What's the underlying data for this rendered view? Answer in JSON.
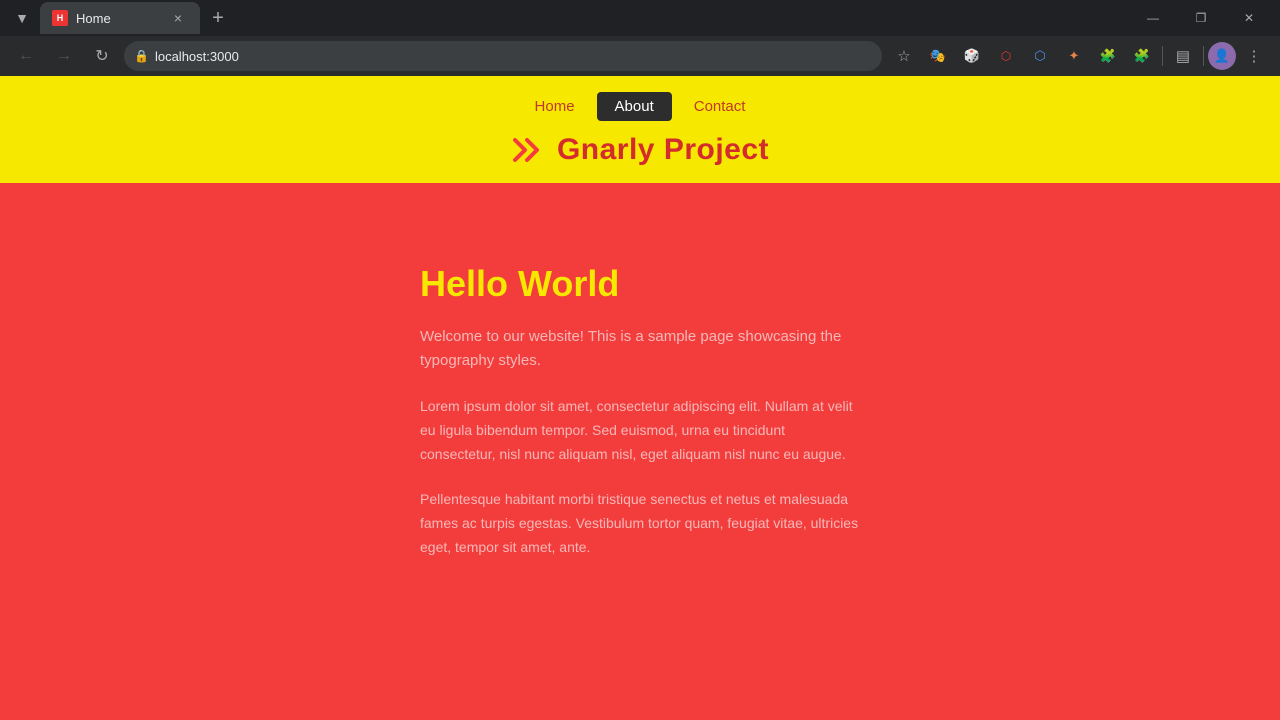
{
  "browser": {
    "tab": {
      "favicon_label": "H",
      "title": "Home",
      "close_label": "×"
    },
    "new_tab_label": "+",
    "window_controls": {
      "minimize": "—",
      "maximize": "❐",
      "close": "✕"
    },
    "toolbar": {
      "back_label": "←",
      "forward_label": "→",
      "reload_label": "↻",
      "url": "localhost:3000",
      "bookmark_label": "☆",
      "menu_label": "⋮"
    }
  },
  "site": {
    "nav": {
      "home_label": "Home",
      "about_label": "About",
      "contact_label": "Contact"
    },
    "title": "Gnarly Project",
    "heading": "Hello World",
    "intro": "Welcome to our website! This is a sample page showcasing the typography styles.",
    "paragraph1": "Lorem ipsum dolor sit amet, consectetur adipiscing elit. Nullam at velit eu ligula bibendum tempor. Sed euismod, urna eu tincidunt consectetur, nisl nunc aliquam nisl, eget aliquam nisl nunc eu augue.",
    "paragraph2": "Pellentesque habitant morbi tristique senectus et netus et malesuada fames ac turpis egestas. Vestibulum tortor quam, feugiat vitae, ultricies eget, tempor sit amet, ante."
  }
}
